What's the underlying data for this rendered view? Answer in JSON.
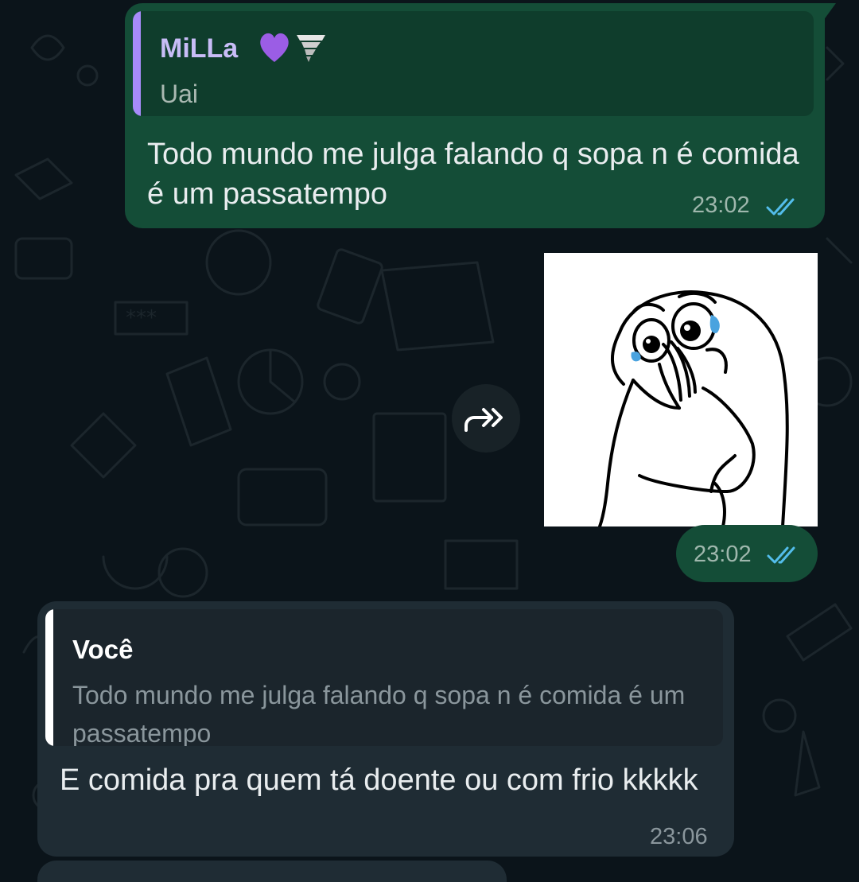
{
  "colors": {
    "chat_background": "#0b141a",
    "outgoing_bubble": "#144d37",
    "incoming_bubble": "#1f2c34",
    "read_ticks": "#53bdeb",
    "quote_bar_purple": "#a78bfa"
  },
  "messages": [
    {
      "direction": "outgoing",
      "type": "text",
      "reply_to": {
        "author": "MiLLa",
        "author_emoji": [
          "purple-heart-icon",
          "tornado-icon"
        ],
        "text": "Uai"
      },
      "text": "Todo mundo me julga falando q sopa n é comida é um passatempo",
      "time": "23:02",
      "status_icon": "double-check-read-icon"
    },
    {
      "direction": "outgoing",
      "type": "sticker",
      "sticker": "crying-meme-face-sticker",
      "forward_icon": "forward-icon",
      "time": "23:02",
      "status_icon": "double-check-read-icon"
    },
    {
      "direction": "incoming",
      "type": "text",
      "reply_to": {
        "author": "Você",
        "text": "Todo mundo me julga falando q sopa n é comida é um passatempo"
      },
      "text": "E comida pra quem tá doente ou com frio kkkkk",
      "time": "23:06"
    }
  ]
}
